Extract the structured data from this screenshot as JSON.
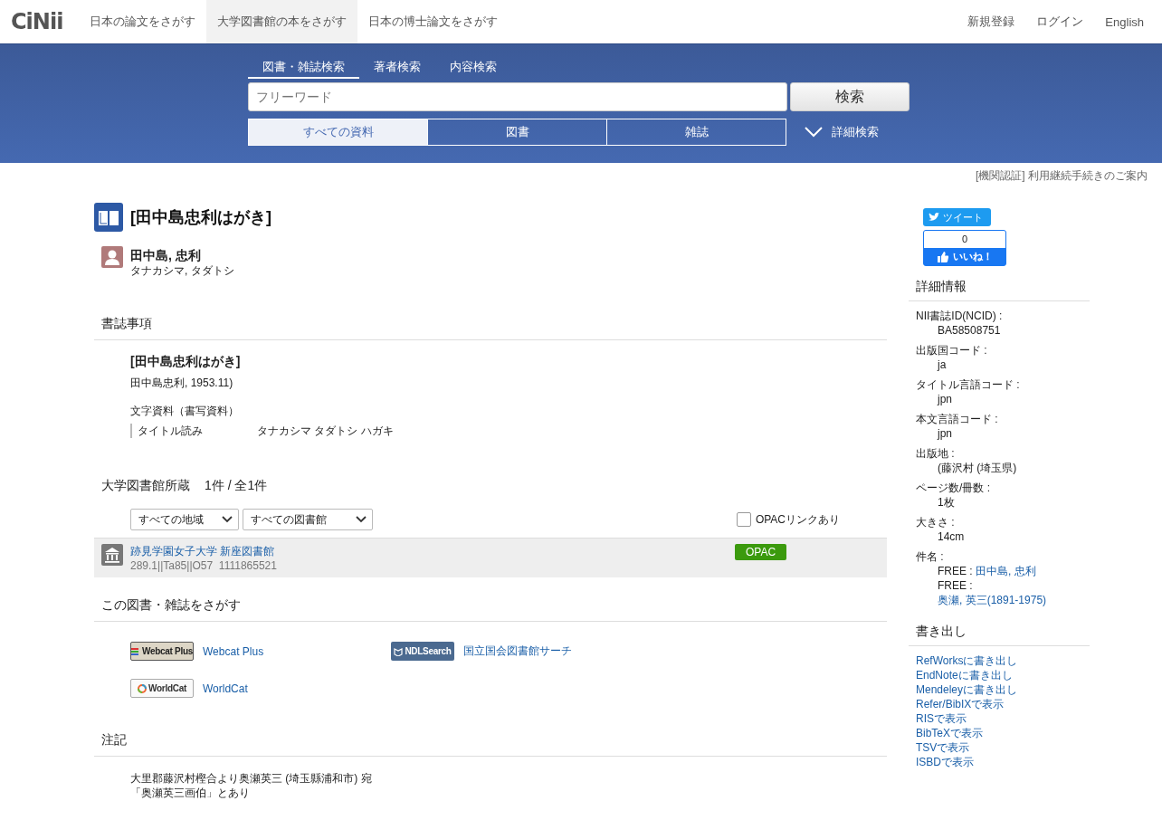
{
  "header": {
    "logo": "CiNii",
    "nav": [
      {
        "label": "日本の論文をさがす",
        "selected": false
      },
      {
        "label": "大学図書館の本をさがす",
        "selected": true
      },
      {
        "label": "日本の博士論文をさがす",
        "selected": false
      }
    ],
    "account_links": [
      "新規登録",
      "ログイン",
      "English"
    ]
  },
  "search": {
    "tabs": [
      {
        "label": "図書・雑誌検索",
        "selected": true
      },
      {
        "label": "著者検索",
        "selected": false
      },
      {
        "label": "内容検索",
        "selected": false
      }
    ],
    "placeholder": "フリーワード",
    "button": "検索",
    "types": [
      {
        "label": "すべての資料",
        "selected": true
      },
      {
        "label": "図書",
        "selected": false
      },
      {
        "label": "雑誌",
        "selected": false
      }
    ],
    "advanced": "詳細検索"
  },
  "notice": "[機関認証] 利用継続手続きのご案内",
  "record": {
    "title": "[田中島忠利はがき]",
    "author": {
      "name": "田中島, 忠利",
      "reading": "タナカシマ, タダトシ"
    }
  },
  "bibliography": {
    "heading": "書誌事項",
    "title": "[田中島忠利はがき]",
    "publication": "田中島忠利, 1953.11)",
    "material_type": "文字資料（書写資料）",
    "fields": [
      {
        "label": "タイトル読み",
        "value": "タナカシマ タダトシ ハガキ"
      }
    ]
  },
  "holdings": {
    "heading": "大学図書館所蔵",
    "count": "1件 / 全1件",
    "region_filter": "すべての地域",
    "library_filter": "すべての図書館",
    "opac_filter": {
      "label": "OPACリンクあり",
      "checked": false
    },
    "rows": [
      {
        "library": "跡見学園女子大学 新座図書館",
        "call_number": "289.1||Ta85||O57  1111865521",
        "opac": "OPAC"
      }
    ]
  },
  "find_elsewhere": {
    "heading": "この図書・雑誌をさがす",
    "links": [
      {
        "kind": "webcat",
        "logo": "Webcat Plus",
        "label": "Webcat Plus"
      },
      {
        "kind": "ndl",
        "logo": "NDLSearch",
        "label": "国立国会図書館サーチ"
      },
      {
        "kind": "worldcat",
        "logo": "WorldCat",
        "label": "WorldCat"
      }
    ]
  },
  "notes": {
    "heading": "注記",
    "lines": [
      "大里郡藤沢村樫合より奥瀬英三 (埼玉縣浦和市) 宛",
      "「奥瀬英三画伯」とあり"
    ]
  },
  "share": {
    "tweet": "ツイート",
    "like_count": "0",
    "like": "いいね！"
  },
  "details": {
    "heading": "詳細情報",
    "items": [
      {
        "label": "NII書誌ID(NCID) :",
        "lines": [
          [
            {
              "kind": "text",
              "text": "BA58508751"
            }
          ]
        ]
      },
      {
        "label": "出版国コード :",
        "lines": [
          [
            {
              "kind": "text",
              "text": "ja"
            }
          ]
        ]
      },
      {
        "label": "タイトル言語コード :",
        "lines": [
          [
            {
              "kind": "text",
              "text": "jpn"
            }
          ]
        ]
      },
      {
        "label": "本文言語コード :",
        "lines": [
          [
            {
              "kind": "text",
              "text": "jpn"
            }
          ]
        ]
      },
      {
        "label": "出版地 :",
        "lines": [
          [
            {
              "kind": "text",
              "text": "(藤沢村 (埼玉県)"
            }
          ]
        ]
      },
      {
        "label": "ページ数/冊数 :",
        "lines": [
          [
            {
              "kind": "text",
              "text": "1枚"
            }
          ]
        ]
      },
      {
        "label": "大きさ :",
        "lines": [
          [
            {
              "kind": "text",
              "text": "14cm"
            }
          ]
        ]
      },
      {
        "label": "件名 :",
        "lines": [
          [
            {
              "kind": "text",
              "text": "FREE :"
            },
            {
              "kind": "link",
              "text": "田中島, 忠利"
            }
          ],
          [
            {
              "kind": "text",
              "text": "FREE :"
            }
          ],
          [
            {
              "kind": "link",
              "text": "奥瀬, 英三(1891-1975)"
            }
          ]
        ]
      }
    ]
  },
  "export": {
    "heading": "書き出し",
    "links": [
      "RefWorksに書き出し",
      "EndNoteに書き出し",
      "Mendeleyに書き出し",
      "Refer/BibIXで表示",
      "RISで表示",
      "BibTeXで表示",
      "TSVで表示",
      "ISBDで表示"
    ]
  }
}
